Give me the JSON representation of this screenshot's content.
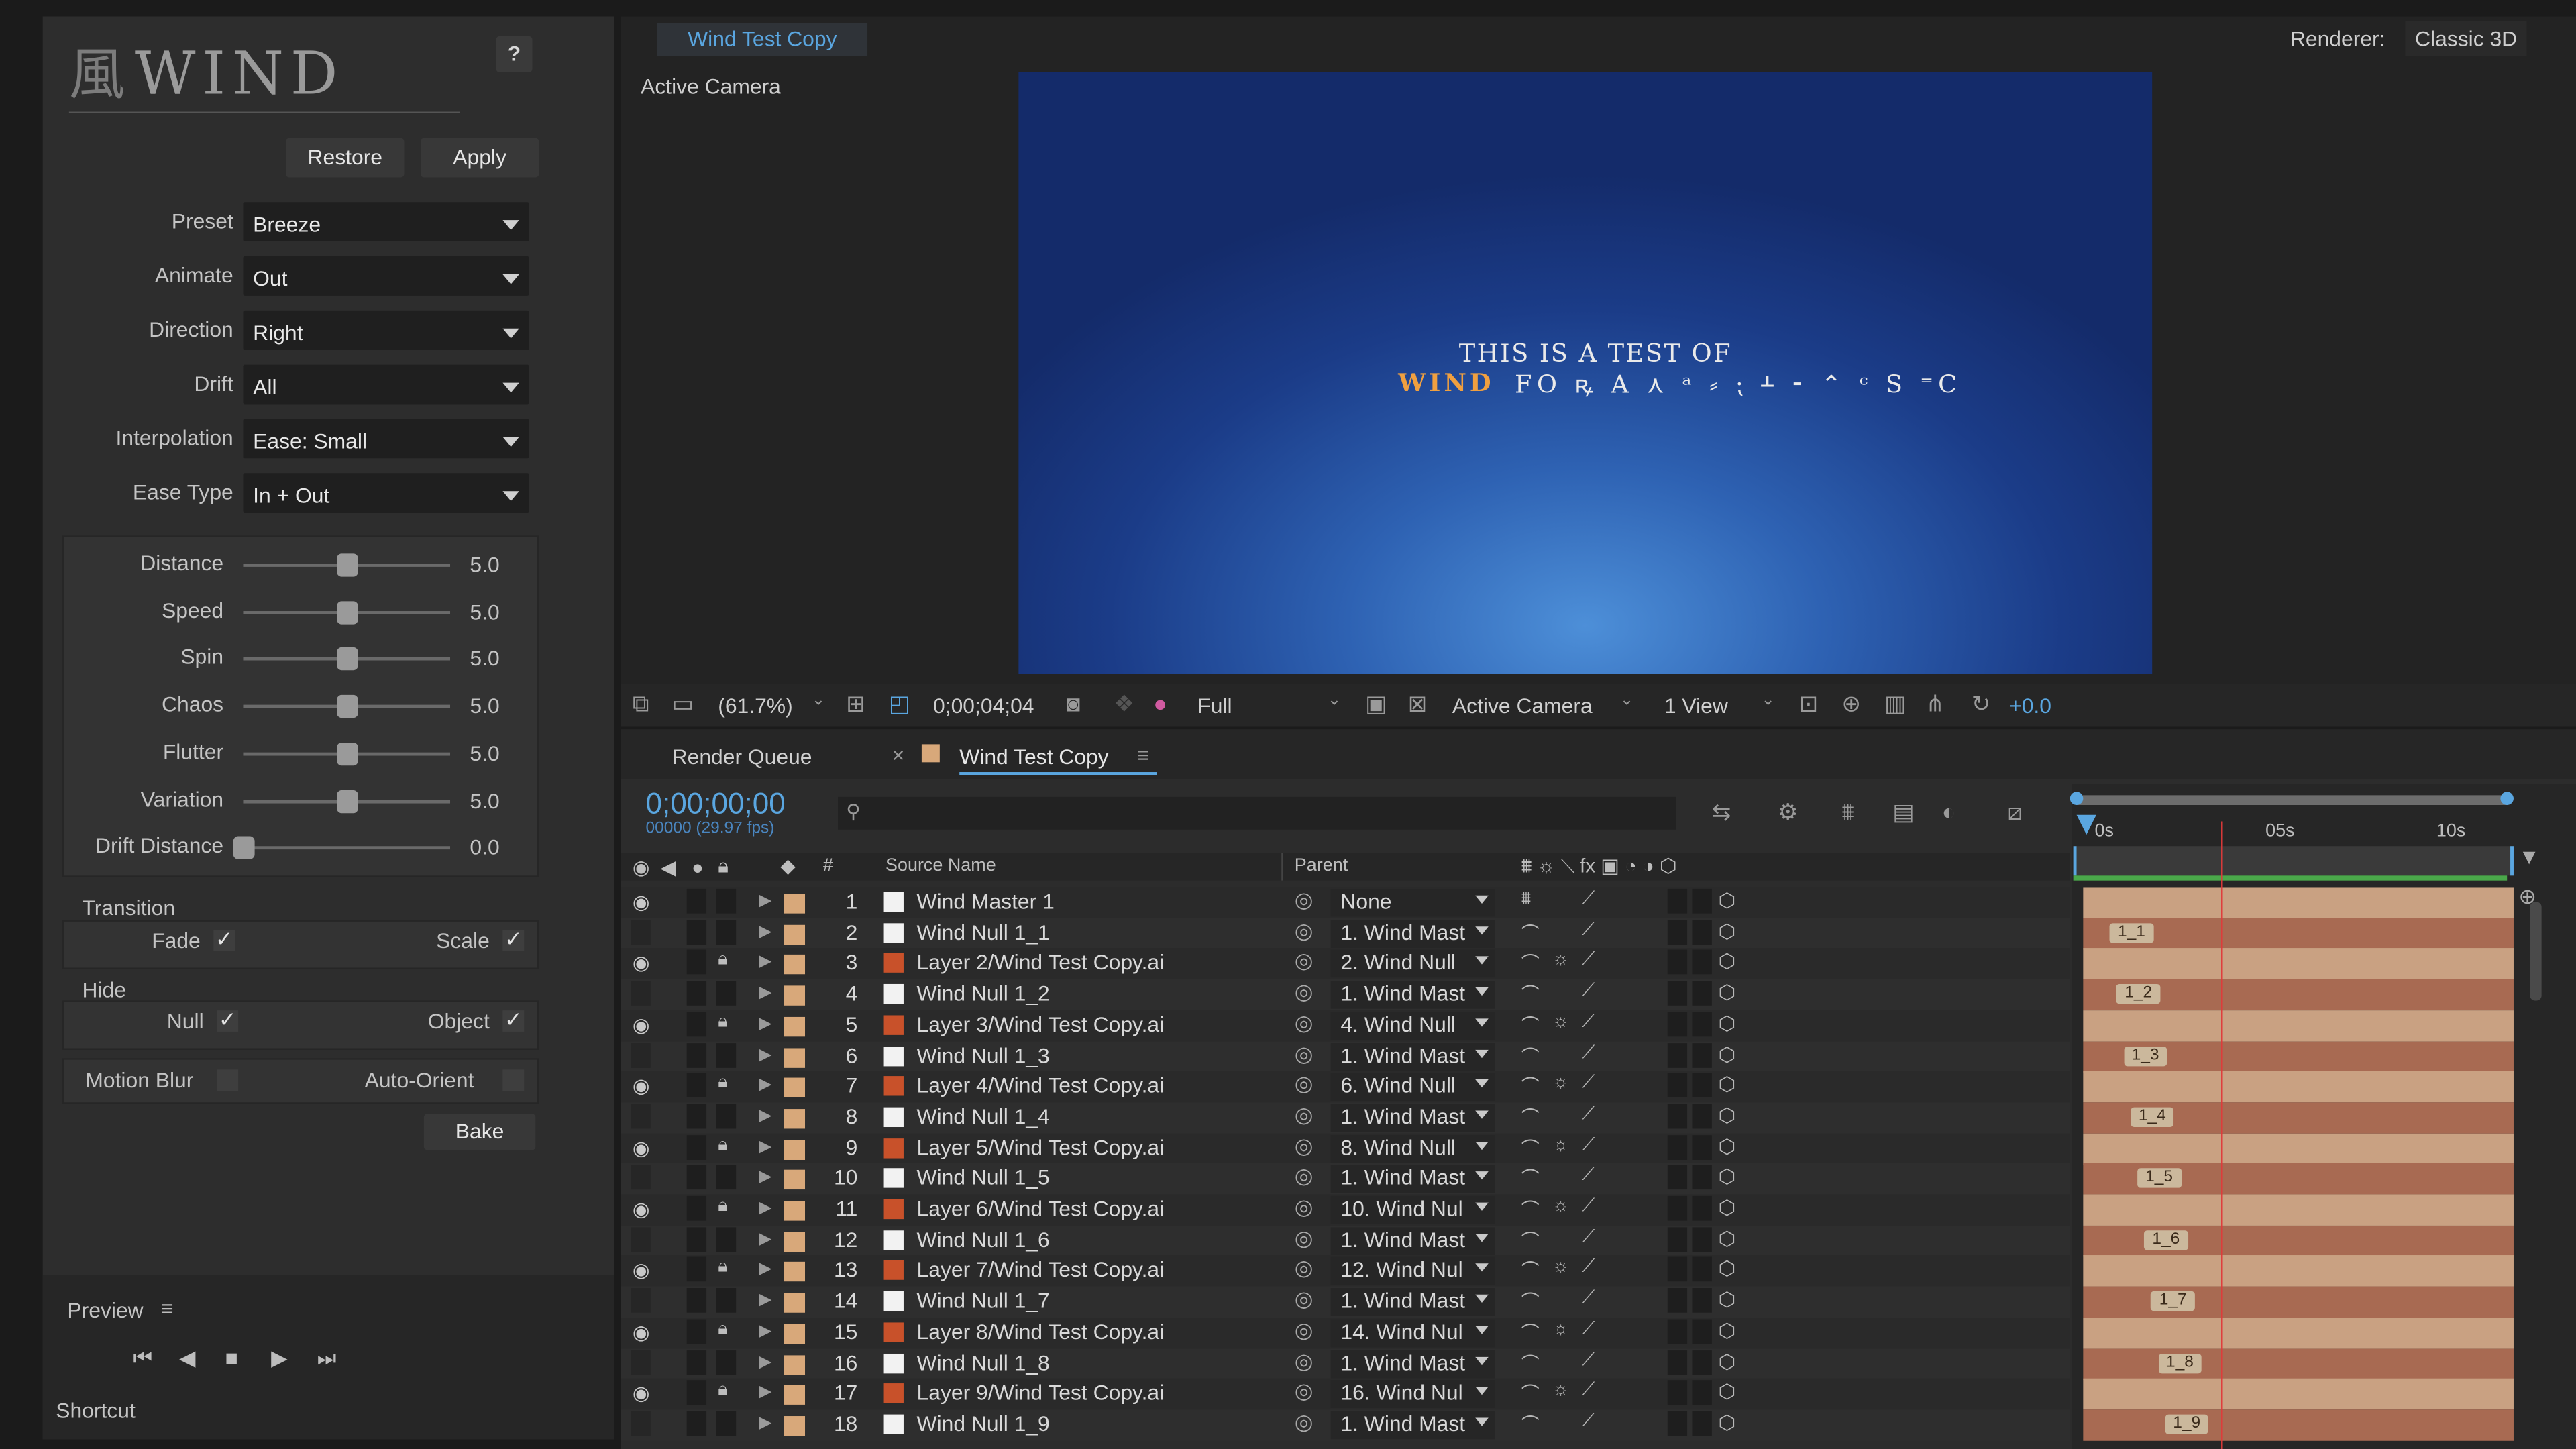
{
  "wind": {
    "logo_text": "WIND",
    "help_label": "?",
    "restore_label": "Restore",
    "apply_label": "Apply",
    "fields": [
      {
        "label": "Preset",
        "value": "Breeze"
      },
      {
        "label": "Animate",
        "value": "Out"
      },
      {
        "label": "Direction",
        "value": "Right"
      },
      {
        "label": "Drift",
        "value": "All"
      },
      {
        "label": "Interpolation",
        "value": "Ease: Small"
      },
      {
        "label": "Ease Type",
        "value": "In + Out"
      }
    ],
    "sliders": [
      {
        "label": "Distance",
        "value": "5.0",
        "level": 0.5
      },
      {
        "label": "Speed",
        "value": "5.0",
        "level": 0.5
      },
      {
        "label": "Spin",
        "value": "5.0",
        "level": 0.5
      },
      {
        "label": "Chaos",
        "value": "5.0",
        "level": 0.5
      },
      {
        "label": "Flutter",
        "value": "5.0",
        "level": 0.5
      },
      {
        "label": "Variation",
        "value": "5.0",
        "level": 0.5
      },
      {
        "label": "Drift Distance",
        "value": "0.0",
        "level": 0.0
      }
    ],
    "transition_label": "Transition",
    "fade_label": "Fade",
    "scale_label": "Scale",
    "hide_label": "Hide",
    "null_label": "Null",
    "object_label": "Object",
    "motion_blur_label": "Motion Blur",
    "auto_orient_label": "Auto-Orient",
    "bake_label": "Bake",
    "check_mark": "✓"
  },
  "preview": {
    "title": "Preview",
    "menu_icon": "≡",
    "shortcut_label": "Shortcut",
    "controls": [
      "⏮",
      "◀",
      "■",
      "▶",
      "⏭"
    ]
  },
  "viewer": {
    "tab_title": "Wind Test Copy",
    "renderer_label": "Renderer:",
    "renderer_value": "Classic 3D",
    "camera_label": "Active Camera",
    "canvas_line1": "THIS IS A TEST OF",
    "canvas_wind": "WIND",
    "canvas_rest": "FO ꝶ A ⋏ ᵃ ⸗ ⁏ ᚆ ⁃ ⌃ ᶜ S ⁼C",
    "zoom": "(61.7%)",
    "timecode": "0;00;04;04",
    "resolution": "Full",
    "view_camera": "Active Camera",
    "view_count": "1 View",
    "exposure": "+0.0"
  },
  "timeline": {
    "render_queue_tab": "Render Queue",
    "close_icon": "×",
    "comp_tab": "Wind Test Copy",
    "menu_icon": "≡",
    "current_time": "0;00;00;00",
    "frame_info": "00000 (29.97 fps)",
    "search_placeholder": "",
    "col_hash": "#",
    "col_source": "Source Name",
    "col_parent": "Parent",
    "ruler": [
      "0s",
      "05s",
      "10s"
    ],
    "playhead_fraction": 0.34,
    "layers": [
      {
        "n": "1",
        "name": "Wind Master 1",
        "parent": "None",
        "type": "null",
        "vis": true,
        "locked": false,
        "marker": ""
      },
      {
        "n": "2",
        "name": "Wind Null 1_1",
        "parent": "1. Wind Mast",
        "type": "null",
        "vis": false,
        "locked": false,
        "marker": "1_1"
      },
      {
        "n": "3",
        "name": "Layer 2/Wind Test Copy.ai",
        "parent": "2. Wind Null",
        "type": "ai",
        "vis": true,
        "locked": true,
        "marker": ""
      },
      {
        "n": "4",
        "name": "Wind Null 1_2",
        "parent": "1. Wind Mast",
        "type": "null",
        "vis": false,
        "locked": false,
        "marker": "1_2"
      },
      {
        "n": "5",
        "name": "Layer 3/Wind Test Copy.ai",
        "parent": "4. Wind Null",
        "type": "ai",
        "vis": true,
        "locked": true,
        "marker": ""
      },
      {
        "n": "6",
        "name": "Wind Null 1_3",
        "parent": "1. Wind Mast",
        "type": "null",
        "vis": false,
        "locked": false,
        "marker": "1_3"
      },
      {
        "n": "7",
        "name": "Layer 4/Wind Test Copy.ai",
        "parent": "6. Wind Null",
        "type": "ai",
        "vis": true,
        "locked": true,
        "marker": ""
      },
      {
        "n": "8",
        "name": "Wind Null 1_4",
        "parent": "1. Wind Mast",
        "type": "null",
        "vis": false,
        "locked": false,
        "marker": "1_4"
      },
      {
        "n": "9",
        "name": "Layer 5/Wind Test Copy.ai",
        "parent": "8. Wind Null",
        "type": "ai",
        "vis": true,
        "locked": true,
        "marker": ""
      },
      {
        "n": "10",
        "name": "Wind Null 1_5",
        "parent": "1. Wind Mast",
        "type": "null",
        "vis": false,
        "locked": false,
        "marker": "1_5"
      },
      {
        "n": "11",
        "name": "Layer 6/Wind Test Copy.ai",
        "parent": "10. Wind Nul",
        "type": "ai",
        "vis": true,
        "locked": true,
        "marker": ""
      },
      {
        "n": "12",
        "name": "Wind Null 1_6",
        "parent": "1. Wind Mast",
        "type": "null",
        "vis": false,
        "locked": false,
        "marker": "1_6"
      },
      {
        "n": "13",
        "name": "Layer 7/Wind Test Copy.ai",
        "parent": "12. Wind Nul",
        "type": "ai",
        "vis": true,
        "locked": true,
        "marker": ""
      },
      {
        "n": "14",
        "name": "Wind Null 1_7",
        "parent": "1. Wind Mast",
        "type": "null",
        "vis": false,
        "locked": false,
        "marker": "1_7"
      },
      {
        "n": "15",
        "name": "Layer 8/Wind Test Copy.ai",
        "parent": "14. Wind Nul",
        "type": "ai",
        "vis": true,
        "locked": true,
        "marker": ""
      },
      {
        "n": "16",
        "name": "Wind Null 1_8",
        "parent": "1. Wind Mast",
        "type": "null",
        "vis": false,
        "locked": false,
        "marker": "1_8"
      },
      {
        "n": "17",
        "name": "Layer 9/Wind Test Copy.ai",
        "parent": "16. Wind Nul",
        "type": "ai",
        "vis": true,
        "locked": true,
        "marker": ""
      },
      {
        "n": "18",
        "name": "Wind Null 1_9",
        "parent": "1. Wind Mast",
        "type": "null",
        "vis": false,
        "locked": false,
        "marker": "1_9"
      }
    ]
  },
  "colors": {
    "accent_blue": "#5aa6e0",
    "layer_label": "#d8a87a",
    "ai_icon": "#c8512a",
    "bar_fill": "#a86a52",
    "work_area": "#4aa84a",
    "playhead": "#e03a3a"
  }
}
